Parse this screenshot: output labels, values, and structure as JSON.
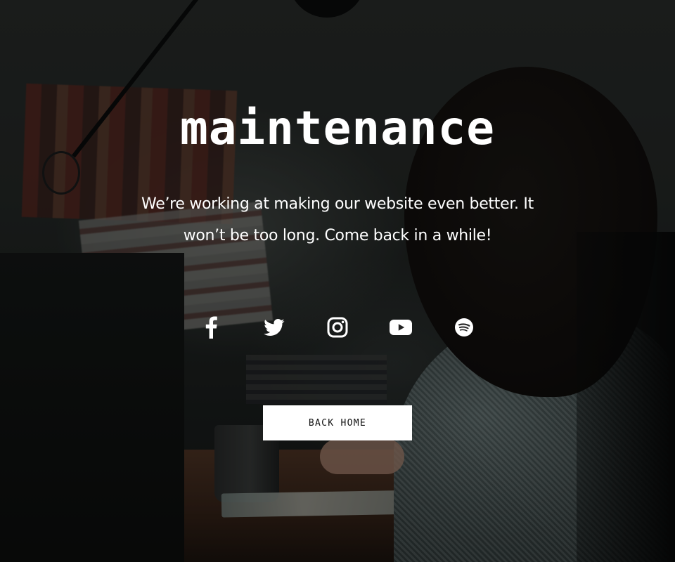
{
  "hero": {
    "title": "maintenance",
    "message": "We’re working at making our website even better. It won’t be too long. Come back in a while!"
  },
  "social_links": [
    {
      "icon": "facebook-icon"
    },
    {
      "icon": "twitter-icon"
    },
    {
      "icon": "instagram-icon"
    },
    {
      "icon": "youtube-icon"
    },
    {
      "icon": "spotify-icon"
    }
  ],
  "cta": {
    "back_home_label": "BACK HOME"
  },
  "colors": {
    "text": "#ffffff",
    "button_bg": "#ffffff",
    "button_text": "#111111",
    "overlay": "#000000"
  }
}
